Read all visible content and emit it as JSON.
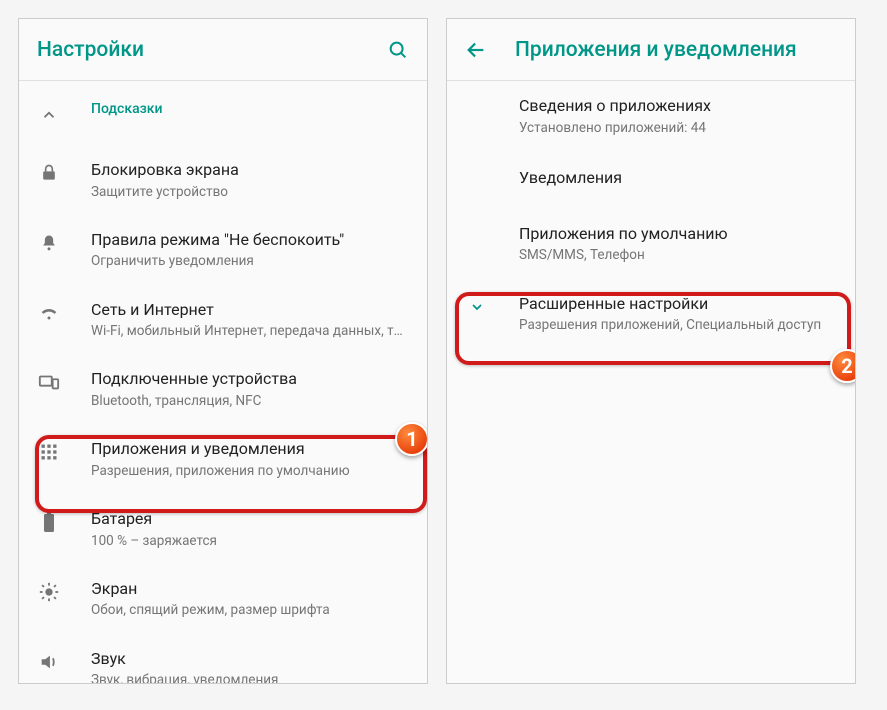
{
  "accent": "#009688",
  "left": {
    "title": "Настройки",
    "suggestions_label": "Подсказки",
    "items": [
      {
        "title": "Блокировка экрана",
        "sub": "Защитите устройство"
      },
      {
        "title": "Правила режима \"Не беспокоить\"",
        "sub": "Ограничить уведомления"
      },
      {
        "title": "Сеть и Интернет",
        "sub": "Wi-Fi, мобильный Интернет, передача данных, т…"
      },
      {
        "title": "Подключенные устройства",
        "sub": "Bluetooth, трансляция, NFC"
      },
      {
        "title": "Приложения и уведомления",
        "sub": "Разрешения, приложения по умолчанию"
      },
      {
        "title": "Батарея",
        "sub": "100 % – заряжается"
      },
      {
        "title": "Экран",
        "sub": "Обои, спящий режим, размер шрифта"
      },
      {
        "title": "Звук",
        "sub": "Звук, вибрация, уведомления"
      }
    ],
    "badge": "1"
  },
  "right": {
    "title": "Приложения и уведомления",
    "items": [
      {
        "title": "Сведения о приложениях",
        "sub": "Установлено приложений: 44"
      },
      {
        "title": "Уведомления",
        "sub": ""
      },
      {
        "title": "Приложения по умолчанию",
        "sub": "SMS/MMS, Телефон"
      },
      {
        "title": "Расширенные настройки",
        "sub": "Разрешения приложений, Специальный доступ"
      }
    ],
    "badge": "2"
  }
}
